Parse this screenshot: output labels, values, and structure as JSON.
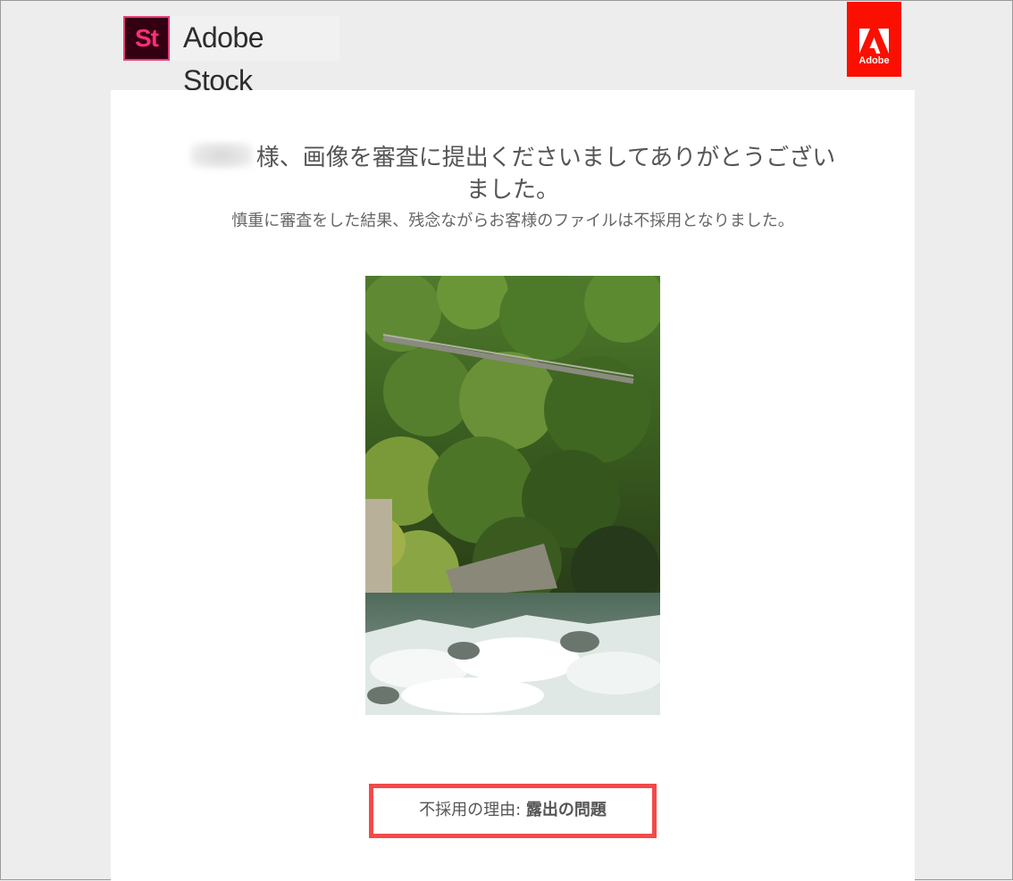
{
  "header": {
    "app_icon_label": "St",
    "app_name": "Adobe Stock",
    "brand_badge_label": "Adobe",
    "brand_color": "#fa0f00",
    "app_icon_color": "#ff2e78"
  },
  "message": {
    "greeting_title_line1": "様、画像を審査に提出くださいましてありがとうござい",
    "greeting_title_line2": "ました。",
    "subtitle": "慎重に審査をした結果、残念ながらお客様のファイルは不採用となりました。"
  },
  "submission": {
    "photo_subject": "waterfall-gorge-bridge-photo"
  },
  "rejection": {
    "reason_label": "不採用の理由: ",
    "reason_value": "露出の問題",
    "highlight_color": "#f34a4a"
  }
}
